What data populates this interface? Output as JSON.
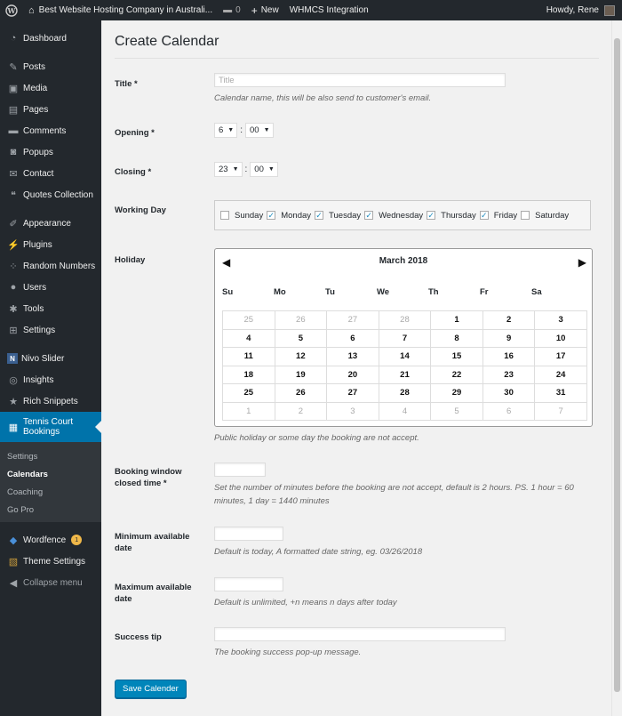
{
  "adminbar": {
    "site_title": "Best Website Hosting Company in Australi...",
    "comments_count": "0",
    "new_label": "New",
    "whmcs_label": "WHMCS Integration",
    "howdy": "Howdy, Rene"
  },
  "sidebar": {
    "items": [
      {
        "label": "Dashboard",
        "icon": "dashboard-icon"
      },
      {
        "label": "Posts",
        "icon": "pin-icon"
      },
      {
        "label": "Media",
        "icon": "media-icon"
      },
      {
        "label": "Pages",
        "icon": "page-icon"
      },
      {
        "label": "Comments",
        "icon": "comment-icon"
      },
      {
        "label": "Popups",
        "icon": "popup-icon"
      },
      {
        "label": "Contact",
        "icon": "mail-icon"
      },
      {
        "label": "Quotes Collection",
        "icon": "quote-icon"
      },
      {
        "label": "Appearance",
        "icon": "brush-icon"
      },
      {
        "label": "Plugins",
        "icon": "plug-icon"
      },
      {
        "label": "Random Numbers",
        "icon": "random-icon"
      },
      {
        "label": "Users",
        "icon": "user-icon"
      },
      {
        "label": "Tools",
        "icon": "wrench-icon"
      },
      {
        "label": "Settings",
        "icon": "settings-icon"
      },
      {
        "label": "Nivo Slider",
        "icon": "nivo-icon"
      },
      {
        "label": "Insights",
        "icon": "insights-icon"
      },
      {
        "label": "Rich Snippets",
        "icon": "star-icon"
      },
      {
        "label": "Tennis Court Bookings",
        "icon": "calendar-icon"
      }
    ],
    "submenu": [
      "Settings",
      "Calendars",
      "Coaching",
      "Go Pro"
    ],
    "bottom": [
      {
        "label": "Wordfence",
        "icon": "wordfence-icon",
        "badge": "1"
      },
      {
        "label": "Theme Settings",
        "icon": "theme-icon"
      },
      {
        "label": "Collapse menu",
        "icon": "collapse-icon"
      }
    ]
  },
  "page": {
    "title": "Create Calendar",
    "title_field": {
      "label": "Title *",
      "placeholder": "Title",
      "desc": "Calendar name, this will be also send to customer's email."
    },
    "opening": {
      "label": "Opening *",
      "hour": "6",
      "minute": "00"
    },
    "closing": {
      "label": "Closing *",
      "hour": "23",
      "minute": "00"
    },
    "working_day": {
      "label": "Working Day",
      "days": [
        {
          "name": "Sunday",
          "checked": false
        },
        {
          "name": "Monday",
          "checked": true
        },
        {
          "name": "Tuesday",
          "checked": true
        },
        {
          "name": "Wednesday",
          "checked": true
        },
        {
          "name": "Thursday",
          "checked": true
        },
        {
          "name": "Friday",
          "checked": true
        },
        {
          "name": "Saturday",
          "checked": false
        }
      ]
    },
    "holiday": {
      "label": "Holiday",
      "month": "March 2018",
      "dow": [
        "Su",
        "Mo",
        "Tu",
        "We",
        "Th",
        "Fr",
        "Sa"
      ],
      "weeks": [
        [
          [
            "25",
            true
          ],
          [
            "26",
            true
          ],
          [
            "27",
            true
          ],
          [
            "28",
            true
          ],
          [
            "1",
            false
          ],
          [
            "2",
            false
          ],
          [
            "3",
            false
          ]
        ],
        [
          [
            "4",
            false
          ],
          [
            "5",
            false
          ],
          [
            "6",
            false
          ],
          [
            "7",
            false
          ],
          [
            "8",
            false
          ],
          [
            "9",
            false
          ],
          [
            "10",
            false
          ]
        ],
        [
          [
            "11",
            false
          ],
          [
            "12",
            false
          ],
          [
            "13",
            false
          ],
          [
            "14",
            false
          ],
          [
            "15",
            false
          ],
          [
            "16",
            false
          ],
          [
            "17",
            false
          ]
        ],
        [
          [
            "18",
            false
          ],
          [
            "19",
            false
          ],
          [
            "20",
            false
          ],
          [
            "21",
            false
          ],
          [
            "22",
            false
          ],
          [
            "23",
            false
          ],
          [
            "24",
            false
          ]
        ],
        [
          [
            "25",
            false
          ],
          [
            "26",
            false
          ],
          [
            "27",
            false
          ],
          [
            "28",
            false
          ],
          [
            "29",
            false
          ],
          [
            "30",
            false
          ],
          [
            "31",
            false
          ]
        ],
        [
          [
            "1",
            true
          ],
          [
            "2",
            true
          ],
          [
            "3",
            true
          ],
          [
            "4",
            true
          ],
          [
            "5",
            true
          ],
          [
            "6",
            true
          ],
          [
            "7",
            true
          ]
        ]
      ],
      "desc": "Public holiday or some day the booking are not accept."
    },
    "booking_window": {
      "label": "Booking window closed time *",
      "desc": "Set the number of minutes before the booking are not accept, default is 2 hours. PS. 1 hour = 60 minutes, 1 day = 1440 minutes"
    },
    "min_date": {
      "label": "Minimum available date",
      "desc": "Default is today, A formatted date string, eg. 03/26/2018"
    },
    "max_date": {
      "label": "Maximum available date",
      "desc": "Default is unlimited, +n means n days after today"
    },
    "success_tip": {
      "label": "Success tip",
      "desc": "The booking success pop-up message."
    },
    "save_label": "Save Calender"
  }
}
